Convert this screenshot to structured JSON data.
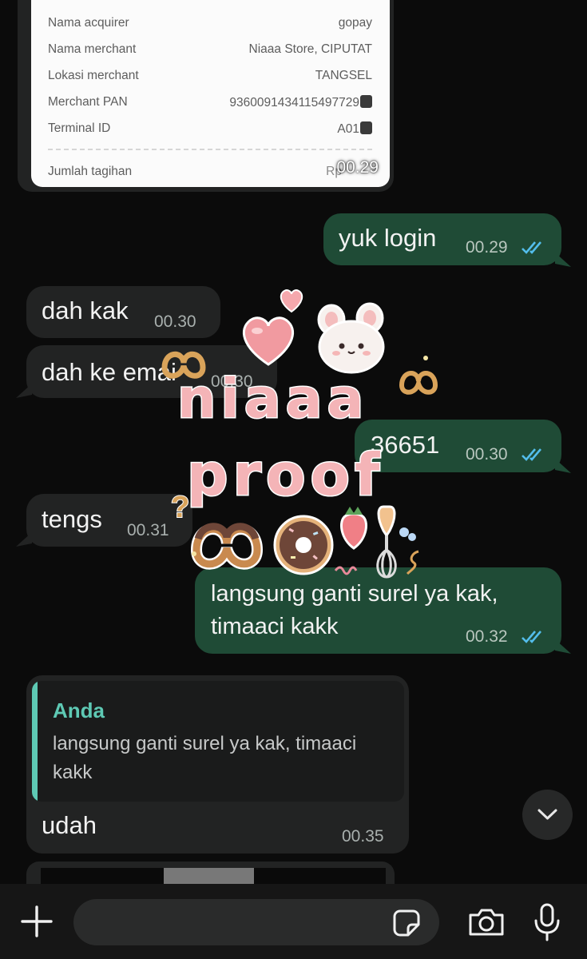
{
  "receipt": {
    "rows": [
      {
        "label": "Nama acquirer",
        "value": "gopay"
      },
      {
        "label": "Nama merchant",
        "value": "Niaaa Store, CIPUTAT"
      },
      {
        "label": "Lokasi merchant",
        "value": "TANGSEL"
      },
      {
        "label": "Merchant PAN",
        "value": "9360091434115497729"
      },
      {
        "label": "Terminal ID",
        "value": "A01"
      }
    ],
    "total_label": "Jumlah tagihan",
    "total_value_partial": "Rp",
    "time": "00.29"
  },
  "messages": [
    {
      "direction": "out",
      "text": "yuk login",
      "time": "00.29",
      "status": "read"
    },
    {
      "direction": "in",
      "text": "dah kak",
      "time": "00.30"
    },
    {
      "direction": "in",
      "text": "dah ke emai",
      "time": "00.30"
    },
    {
      "direction": "out",
      "text": "36651",
      "time": "00.30",
      "status": "read"
    },
    {
      "direction": "in",
      "text": "tengs",
      "time": "00.31"
    },
    {
      "direction": "out",
      "line1": "langsung ganti surel ya kak,",
      "line2": "timaaci kakk",
      "time": "00.32",
      "status": "read"
    },
    {
      "direction": "in",
      "reply_author": "Anda",
      "reply_line1": "langsung ganti surel ya kak, timaaci",
      "reply_line2": "kakk",
      "text": "udah",
      "time": "00.35"
    }
  ],
  "watermark": {
    "line1": "niaaa",
    "line2": "proof"
  },
  "composer": {
    "value": ""
  },
  "colors": {
    "outgoing_bubble": "#1f4b36",
    "incoming_bubble": "#222323",
    "read_ticks": "#53bdeb",
    "reply_accent": "#5ec9b4"
  },
  "icons": [
    "plus-icon",
    "sticker-icon",
    "camera-icon",
    "microphone-icon",
    "chevron-down-icon",
    "read-ticks-icon",
    "copy-icon"
  ]
}
